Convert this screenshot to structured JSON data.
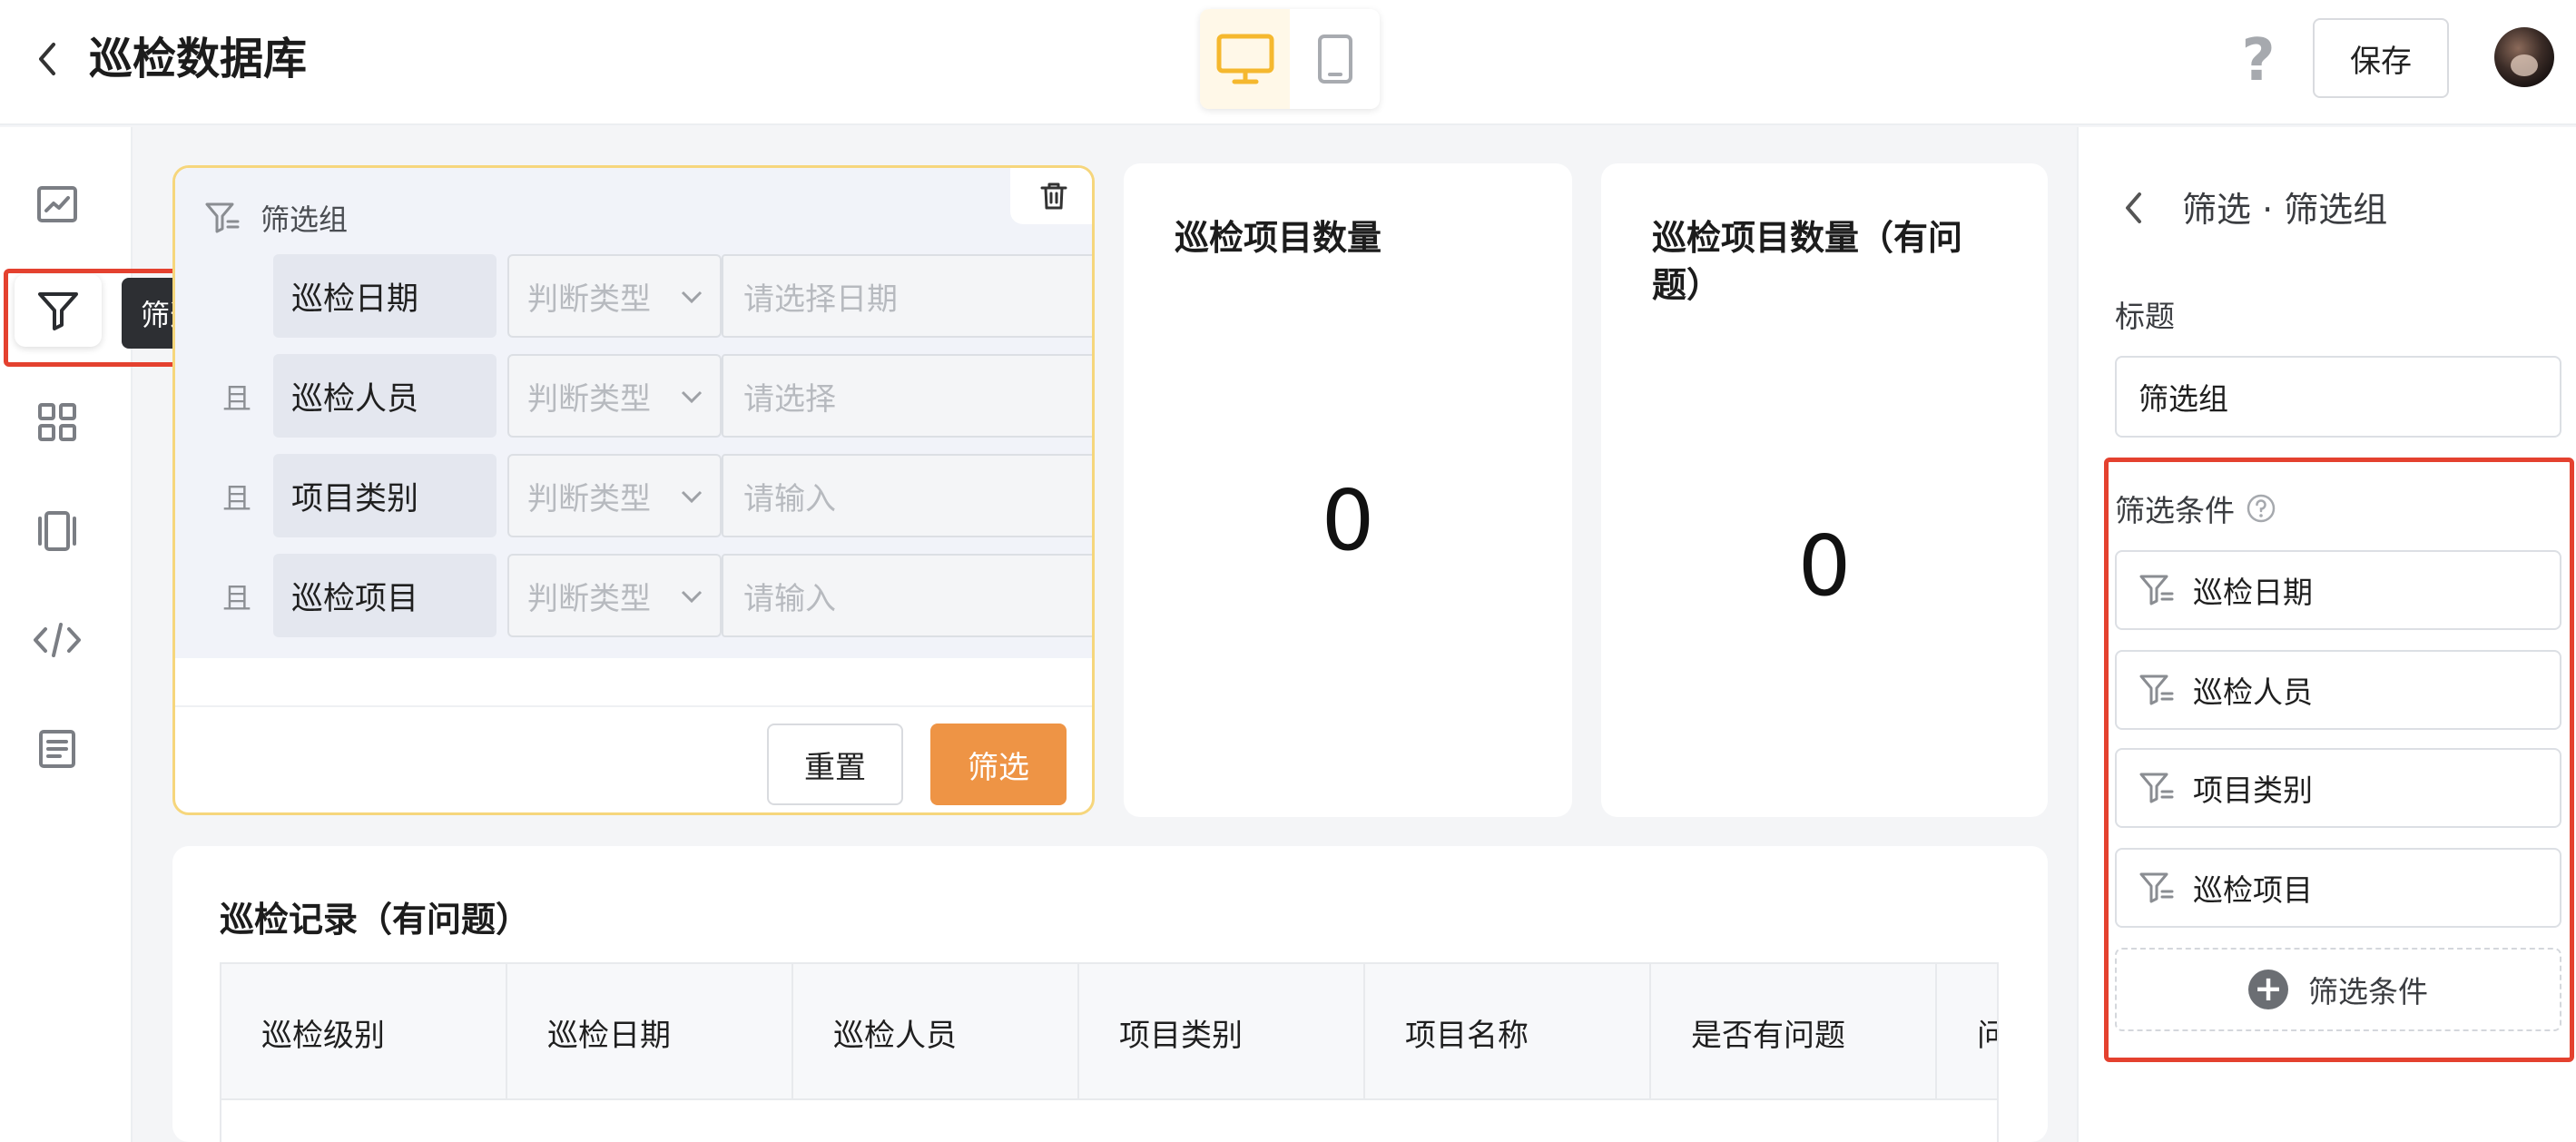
{
  "header": {
    "title": "巡检数据库",
    "save_label": "保存",
    "help_label": "?"
  },
  "leftrail": {
    "tooltip": "筛选",
    "items": [
      "chart-icon",
      "filter-icon",
      "grid-icon",
      "carousel-icon",
      "code-icon",
      "document-icon"
    ]
  },
  "filter_group": {
    "title": "筛选组",
    "rows": [
      {
        "conj": "",
        "field": "巡检日期",
        "type_placeholder": "判断类型",
        "value_placeholder": "请选择日期"
      },
      {
        "conj": "且",
        "field": "巡检人员",
        "type_placeholder": "判断类型",
        "value_placeholder": "请选择"
      },
      {
        "conj": "且",
        "field": "项目类别",
        "type_placeholder": "判断类型",
        "value_placeholder": "请输入"
      },
      {
        "conj": "且",
        "field": "巡检项目",
        "type_placeholder": "判断类型",
        "value_placeholder": "请输入"
      }
    ],
    "reset_label": "重置",
    "filter_label": "筛选"
  },
  "stats": [
    {
      "title": "巡检项目数量",
      "value": "0"
    },
    {
      "title_line1": "巡检项目数量（有问",
      "title_line2": "题）",
      "value": "0"
    }
  ],
  "table": {
    "title": "巡检记录（有问题）",
    "columns": [
      "巡检级别",
      "巡检日期",
      "巡检人员",
      "项目类别",
      "项目名称",
      "是否有问题",
      "问"
    ]
  },
  "right_panel": {
    "breadcrumb": "筛选 · 筛选组",
    "title_label": "标题",
    "title_value": "筛选组",
    "conditions_label": "筛选条件",
    "conditions": [
      "巡检日期",
      "巡检人员",
      "项目类别",
      "巡检项目"
    ],
    "add_condition_label": "筛选条件"
  },
  "colors": {
    "accent_orange": "#ee9445",
    "card_border_yellow": "#f6d67c",
    "highlight_red": "#e4412f",
    "device_active": "#f5b82e"
  }
}
